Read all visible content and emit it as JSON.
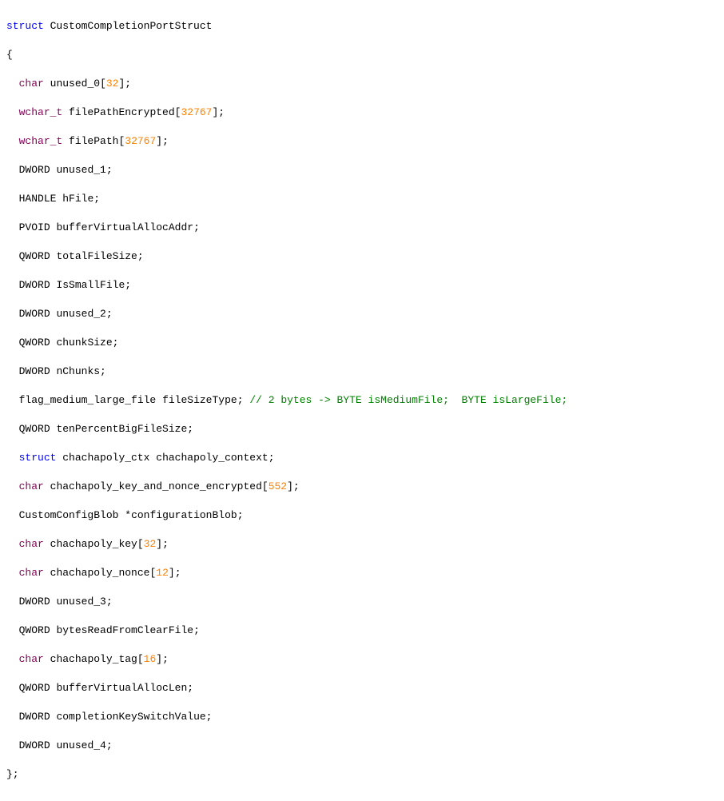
{
  "kw": {
    "struct": "struct"
  },
  "struct_name": "CustomCompletionPortStruct",
  "members": {
    "unused_0": {
      "type": "char",
      "name": "unused_0",
      "arr": "32"
    },
    "filePathEncrypted": {
      "type": "wchar_t",
      "name": "filePathEncrypted",
      "arr": "32767"
    },
    "filePath": {
      "type": "wchar_t",
      "name": "filePath",
      "arr": "32767"
    },
    "unused_1": {
      "type": "DWORD",
      "name": "unused_1"
    },
    "hFile": {
      "type": "HANDLE",
      "name": "hFile"
    },
    "bufferVAAddr": {
      "type": "PVOID",
      "name": "bufferVirtualAllocAddr"
    },
    "totalFileSize": {
      "type": "QWORD",
      "name": "totalFileSize"
    },
    "IsSmallFile": {
      "type": "DWORD",
      "name": "IsSmallFile"
    },
    "unused_2": {
      "type": "DWORD",
      "name": "unused_2"
    },
    "chunkSize": {
      "type": "QWORD",
      "name": "chunkSize"
    },
    "nChunks": {
      "type": "DWORD",
      "name": "nChunks"
    },
    "fileSizeType": {
      "type": "flag_medium_large_file",
      "name": "fileSizeType",
      "comment": "// 2 bytes -> BYTE isMediumFile;  BYTE isLargeFile;"
    },
    "tenPctBig": {
      "type": "QWORD",
      "name": "tenPercentBigFileSize"
    },
    "cc_ctx": {
      "type_prefix": "struct",
      "type": "chachapoly_ctx",
      "name": "chachapoly_context"
    },
    "cc_key_non_enc": {
      "type": "char",
      "name": "chachapoly_key_and_nonce_encrypted",
      "arr": "552"
    },
    "cfgBlob": {
      "type": "CustomConfigBlob",
      "ptr": "*",
      "name": "configurationBlob"
    },
    "cc_key": {
      "type": "char",
      "name": "chachapoly_key",
      "arr": "32"
    },
    "cc_nonce": {
      "type": "char",
      "name": "chachapoly_nonce",
      "arr": "12"
    },
    "unused_3": {
      "type": "DWORD",
      "name": "unused_3"
    },
    "bytesRead": {
      "type": "QWORD",
      "name": "bytesReadFromClearFile"
    },
    "cc_tag": {
      "type": "char",
      "name": "chachapoly_tag",
      "arr": "16"
    },
    "bufVALen": {
      "type": "QWORD",
      "name": "bufferVirtualAllocLen"
    },
    "compKeySw": {
      "type": "DWORD",
      "name": "completionKeySwitchValue"
    },
    "unused_4": {
      "type": "DWORD",
      "name": "unused_4"
    }
  },
  "punct": {
    "open": "{",
    "close": "};",
    "semi": ";",
    "space2": "  ",
    "lbrkt": "[",
    "rbrkt": "]",
    "spc": " "
  }
}
